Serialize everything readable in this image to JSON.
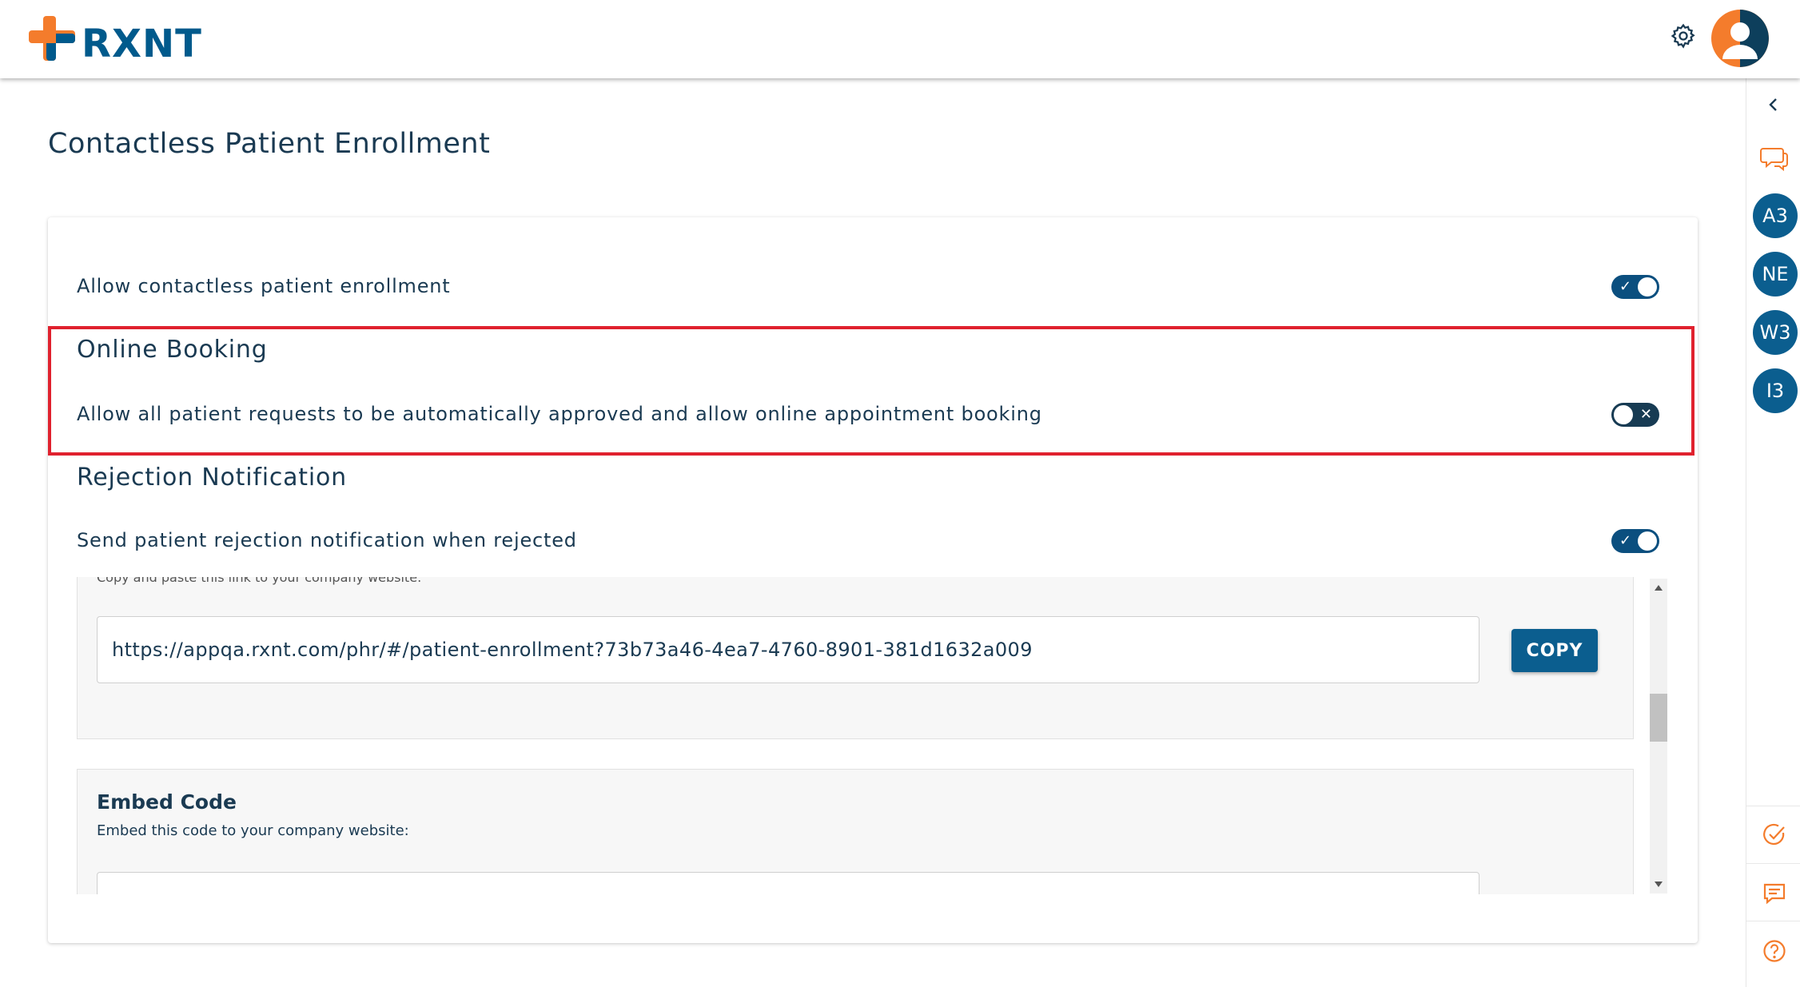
{
  "header": {
    "logo_text": "RXNT",
    "brand_colors": {
      "orange": "#f47c2c",
      "blue": "#005a8c"
    },
    "icons": [
      "settings-gear-icon",
      "user-avatar-icon"
    ]
  },
  "right_rail": {
    "badges": [
      "A3",
      "NE",
      "W3",
      "I3"
    ],
    "icons": [
      "chevron-left-icon",
      "chat-bubbles-icon",
      "check-circle-icon",
      "message-icon",
      "help-icon"
    ]
  },
  "page": {
    "title": "Contactless Patient Enrollment"
  },
  "settings": {
    "enrollment": {
      "label": "Allow contactless patient enrollment",
      "enabled": true,
      "toggle_mark": "✓"
    },
    "online_booking": {
      "title": "Online Booking",
      "label": "Allow all patient requests to be automatically approved and allow online appointment booking",
      "enabled": false,
      "toggle_mark": "✕"
    },
    "rejection": {
      "title": "Rejection Notification",
      "label": "Send patient rejection notification when rejected",
      "enabled": true,
      "toggle_mark": "✓"
    }
  },
  "link_section": {
    "hint": "Copy and paste this link to your company website:",
    "url": "https://appqa.rxnt.com/phr/#/patient-enrollment?73b73a46-4ea7-4760-8901-381d1632a009",
    "copy_label": "COPY"
  },
  "embed_section": {
    "title": "Embed Code",
    "subtitle": "Embed this code to your company website:"
  },
  "colors": {
    "toggle_on": "#0b4f7f",
    "badge": "#0b5e8f",
    "highlight": "#e0212e",
    "rail_icon": "#f47c2c"
  }
}
